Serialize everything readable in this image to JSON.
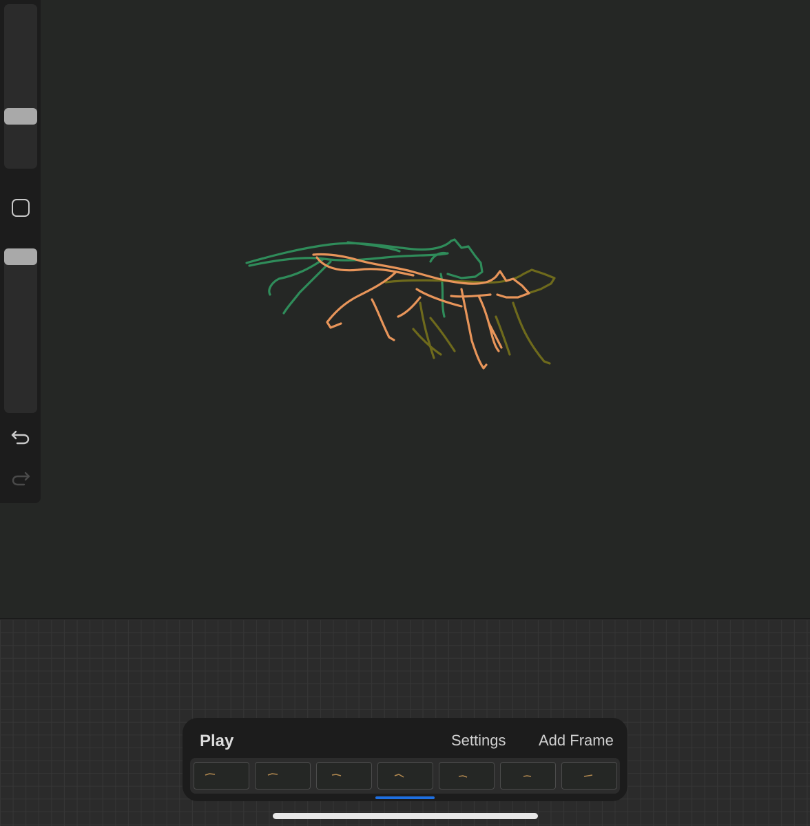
{
  "animation_panel": {
    "play_label": "Play",
    "settings_label": "Settings",
    "add_frame_label": "Add Frame",
    "frame_count": 7,
    "selected_frame": 4
  },
  "sidebar": {
    "brush_size_level": 0.32,
    "opacity_level": 0.06,
    "icons": [
      "modify-square-icon",
      "undo-icon",
      "redo-icon"
    ]
  },
  "colors": {
    "canvas": "#252725",
    "onion_skin_prev": "#2f8c5a",
    "current_frame": "#e8955a",
    "onion_skin_next": "#6e6a1c",
    "selection_accent": "#1e6fe0"
  }
}
